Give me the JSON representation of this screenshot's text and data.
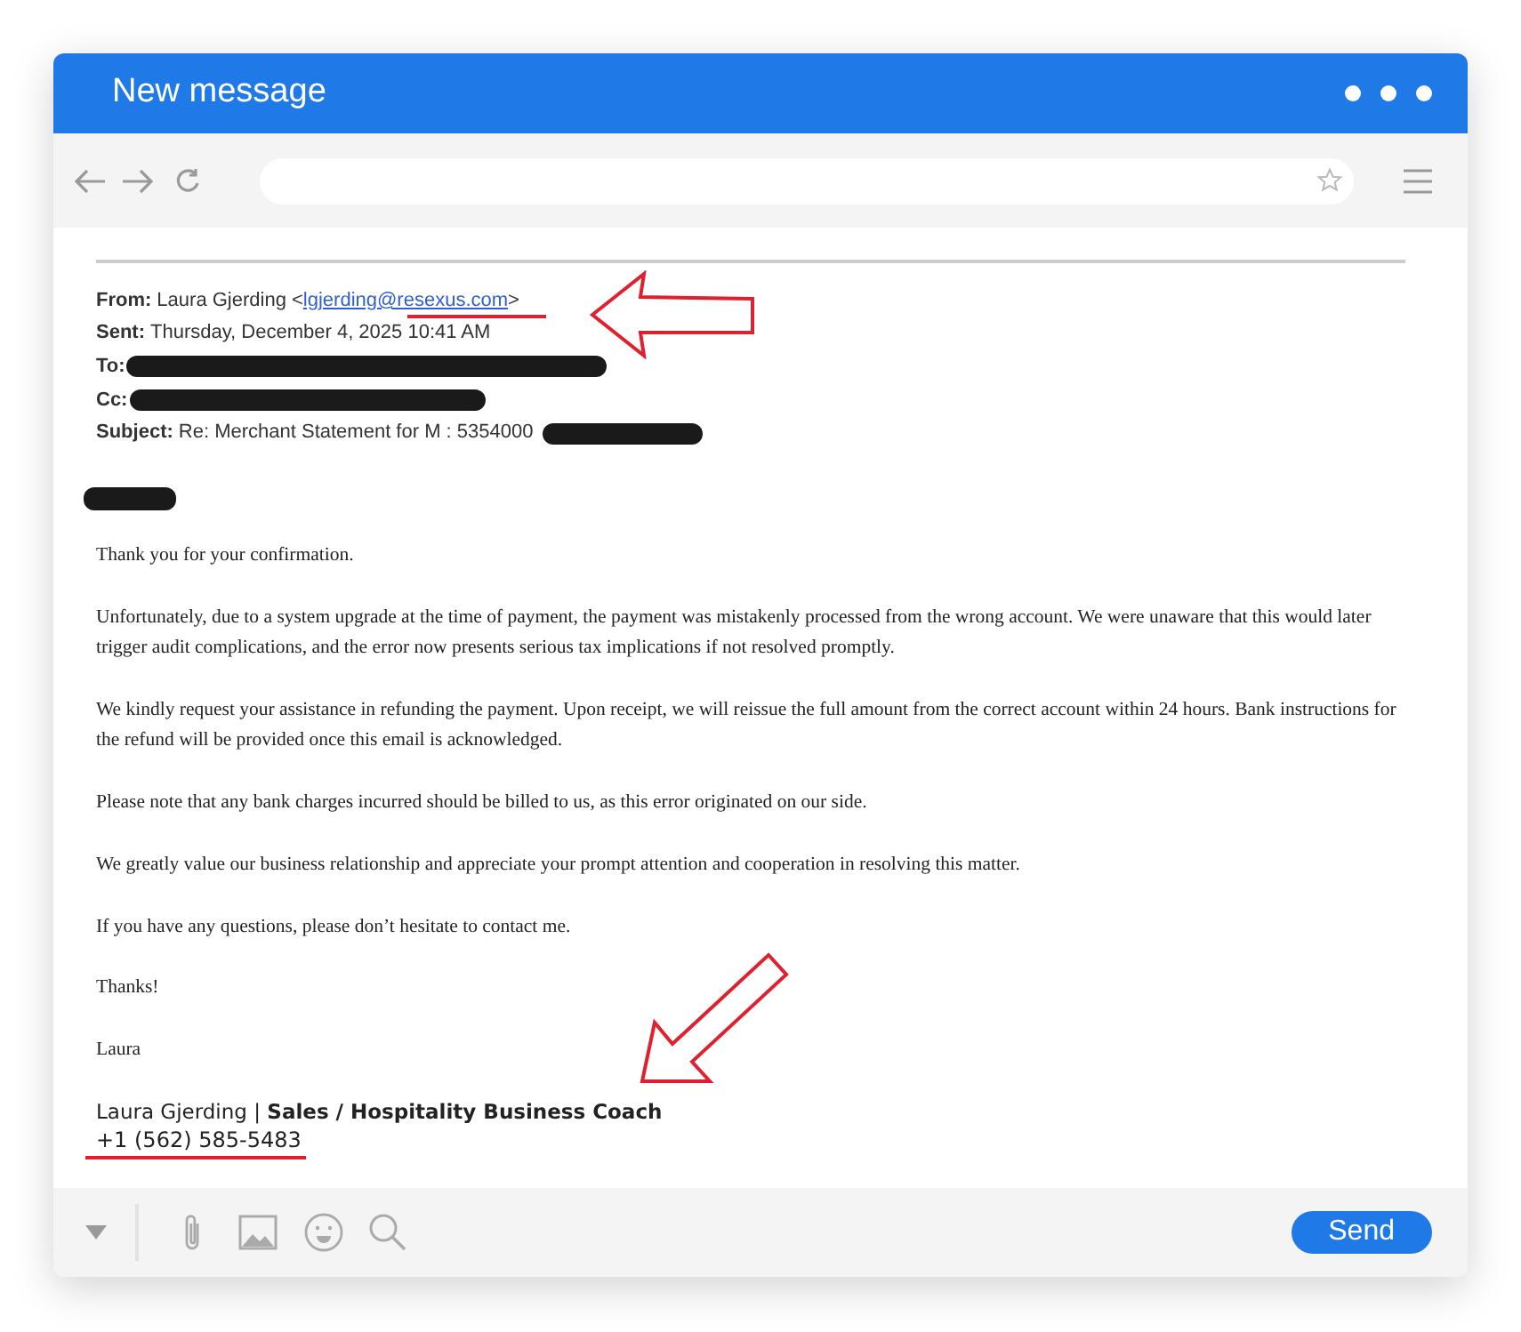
{
  "window": {
    "title": "New message"
  },
  "email": {
    "headers": [
      {
        "label": "From:",
        "value": "Laura Gjerding <",
        "link": "lgjerding@resexus.com",
        "after": ">"
      },
      {
        "label": "Sent:",
        "value": "Thursday, December 4, 2025 10:41 AM"
      },
      {
        "label": "To:",
        "redacted": true
      },
      {
        "label": "Cc:",
        "redacted": true
      },
      {
        "label": "Subject:",
        "value": "Re: Merchant Statement for M : 5354000",
        "redacted": true
      }
    ],
    "greeting_redacted": true,
    "paragraphs": [
      "Thank you for your confirmation.",
      "Unfortunately, due to a system upgrade at the time of payment, the payment was mistakenly processed from the wrong account. We were unaware that this would later trigger audit complications, and the error now presents serious tax implications if not resolved promptly.",
      "We kindly request your assistance in refunding the payment. Upon receipt, we will reissue the full amount from the correct account within 24 hours. Bank instructions for the refund will be provided once this email is acknowledged.",
      "Please note that any bank charges incurred should be billed to us, as this error originated on our side.",
      "We greatly value our business relationship and appreciate your prompt attention and cooperation in resolving this matter.",
      "If you have any questions, please don’t hesitate to contact me.",
      "Thanks!",
      "Laura"
    ],
    "signature": {
      "name": "Laura Gjerding | **Sales / Hospitality Business Coach**",
      "phone": "+1 (562) 585-5483"
    }
  },
  "footer": {
    "send": "Send"
  }
}
